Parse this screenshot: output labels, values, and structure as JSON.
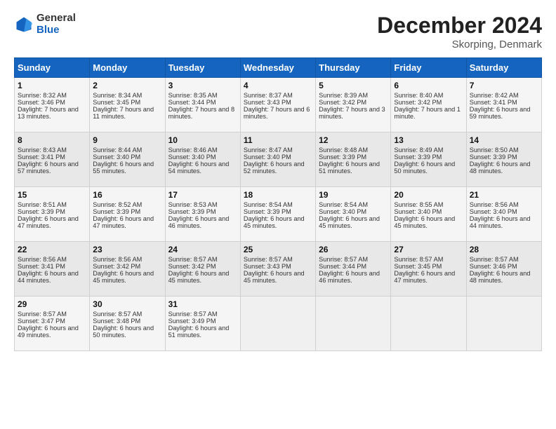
{
  "header": {
    "logo_general": "General",
    "logo_blue": "Blue",
    "title": "December 2024",
    "subtitle": "Skorping, Denmark"
  },
  "days_header": [
    "Sunday",
    "Monday",
    "Tuesday",
    "Wednesday",
    "Thursday",
    "Friday",
    "Saturday"
  ],
  "weeks": [
    [
      {
        "day": "1",
        "sunrise": "Sunrise: 8:32 AM",
        "sunset": "Sunset: 3:46 PM",
        "daylight": "Daylight: 7 hours and 13 minutes."
      },
      {
        "day": "2",
        "sunrise": "Sunrise: 8:34 AM",
        "sunset": "Sunset: 3:45 PM",
        "daylight": "Daylight: 7 hours and 11 minutes."
      },
      {
        "day": "3",
        "sunrise": "Sunrise: 8:35 AM",
        "sunset": "Sunset: 3:44 PM",
        "daylight": "Daylight: 7 hours and 8 minutes."
      },
      {
        "day": "4",
        "sunrise": "Sunrise: 8:37 AM",
        "sunset": "Sunset: 3:43 PM",
        "daylight": "Daylight: 7 hours and 6 minutes."
      },
      {
        "day": "5",
        "sunrise": "Sunrise: 8:39 AM",
        "sunset": "Sunset: 3:42 PM",
        "daylight": "Daylight: 7 hours and 3 minutes."
      },
      {
        "day": "6",
        "sunrise": "Sunrise: 8:40 AM",
        "sunset": "Sunset: 3:42 PM",
        "daylight": "Daylight: 7 hours and 1 minute."
      },
      {
        "day": "7",
        "sunrise": "Sunrise: 8:42 AM",
        "sunset": "Sunset: 3:41 PM",
        "daylight": "Daylight: 6 hours and 59 minutes."
      }
    ],
    [
      {
        "day": "8",
        "sunrise": "Sunrise: 8:43 AM",
        "sunset": "Sunset: 3:41 PM",
        "daylight": "Daylight: 6 hours and 57 minutes."
      },
      {
        "day": "9",
        "sunrise": "Sunrise: 8:44 AM",
        "sunset": "Sunset: 3:40 PM",
        "daylight": "Daylight: 6 hours and 55 minutes."
      },
      {
        "day": "10",
        "sunrise": "Sunrise: 8:46 AM",
        "sunset": "Sunset: 3:40 PM",
        "daylight": "Daylight: 6 hours and 54 minutes."
      },
      {
        "day": "11",
        "sunrise": "Sunrise: 8:47 AM",
        "sunset": "Sunset: 3:40 PM",
        "daylight": "Daylight: 6 hours and 52 minutes."
      },
      {
        "day": "12",
        "sunrise": "Sunrise: 8:48 AM",
        "sunset": "Sunset: 3:39 PM",
        "daylight": "Daylight: 6 hours and 51 minutes."
      },
      {
        "day": "13",
        "sunrise": "Sunrise: 8:49 AM",
        "sunset": "Sunset: 3:39 PM",
        "daylight": "Daylight: 6 hours and 50 minutes."
      },
      {
        "day": "14",
        "sunrise": "Sunrise: 8:50 AM",
        "sunset": "Sunset: 3:39 PM",
        "daylight": "Daylight: 6 hours and 48 minutes."
      }
    ],
    [
      {
        "day": "15",
        "sunrise": "Sunrise: 8:51 AM",
        "sunset": "Sunset: 3:39 PM",
        "daylight": "Daylight: 6 hours and 47 minutes."
      },
      {
        "day": "16",
        "sunrise": "Sunrise: 8:52 AM",
        "sunset": "Sunset: 3:39 PM",
        "daylight": "Daylight: 6 hours and 47 minutes."
      },
      {
        "day": "17",
        "sunrise": "Sunrise: 8:53 AM",
        "sunset": "Sunset: 3:39 PM",
        "daylight": "Daylight: 6 hours and 46 minutes."
      },
      {
        "day": "18",
        "sunrise": "Sunrise: 8:54 AM",
        "sunset": "Sunset: 3:39 PM",
        "daylight": "Daylight: 6 hours and 45 minutes."
      },
      {
        "day": "19",
        "sunrise": "Sunrise: 8:54 AM",
        "sunset": "Sunset: 3:40 PM",
        "daylight": "Daylight: 6 hours and 45 minutes."
      },
      {
        "day": "20",
        "sunrise": "Sunrise: 8:55 AM",
        "sunset": "Sunset: 3:40 PM",
        "daylight": "Daylight: 6 hours and 45 minutes."
      },
      {
        "day": "21",
        "sunrise": "Sunrise: 8:56 AM",
        "sunset": "Sunset: 3:40 PM",
        "daylight": "Daylight: 6 hours and 44 minutes."
      }
    ],
    [
      {
        "day": "22",
        "sunrise": "Sunrise: 8:56 AM",
        "sunset": "Sunset: 3:41 PM",
        "daylight": "Daylight: 6 hours and 44 minutes."
      },
      {
        "day": "23",
        "sunrise": "Sunrise: 8:56 AM",
        "sunset": "Sunset: 3:42 PM",
        "daylight": "Daylight: 6 hours and 45 minutes."
      },
      {
        "day": "24",
        "sunrise": "Sunrise: 8:57 AM",
        "sunset": "Sunset: 3:42 PM",
        "daylight": "Daylight: 6 hours and 45 minutes."
      },
      {
        "day": "25",
        "sunrise": "Sunrise: 8:57 AM",
        "sunset": "Sunset: 3:43 PM",
        "daylight": "Daylight: 6 hours and 45 minutes."
      },
      {
        "day": "26",
        "sunrise": "Sunrise: 8:57 AM",
        "sunset": "Sunset: 3:44 PM",
        "daylight": "Daylight: 6 hours and 46 minutes."
      },
      {
        "day": "27",
        "sunrise": "Sunrise: 8:57 AM",
        "sunset": "Sunset: 3:45 PM",
        "daylight": "Daylight: 6 hours and 47 minutes."
      },
      {
        "day": "28",
        "sunrise": "Sunrise: 8:57 AM",
        "sunset": "Sunset: 3:46 PM",
        "daylight": "Daylight: 6 hours and 48 minutes."
      }
    ],
    [
      {
        "day": "29",
        "sunrise": "Sunrise: 8:57 AM",
        "sunset": "Sunset: 3:47 PM",
        "daylight": "Daylight: 6 hours and 49 minutes."
      },
      {
        "day": "30",
        "sunrise": "Sunrise: 8:57 AM",
        "sunset": "Sunset: 3:48 PM",
        "daylight": "Daylight: 6 hours and 50 minutes."
      },
      {
        "day": "31",
        "sunrise": "Sunrise: 8:57 AM",
        "sunset": "Sunset: 3:49 PM",
        "daylight": "Daylight: 6 hours and 51 minutes."
      },
      null,
      null,
      null,
      null
    ]
  ]
}
